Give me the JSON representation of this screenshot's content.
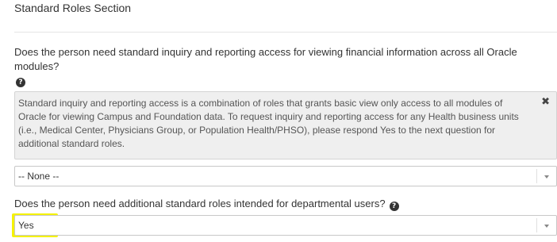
{
  "section": {
    "title": "Standard Roles Section"
  },
  "question1": {
    "text": "Does the person need standard inquiry and reporting access for viewing financial information across all Oracle modules?",
    "help_icon": "question-circle-icon",
    "help_glyph": "?",
    "info_text": "Standard inquiry and reporting access is a combination of roles that grants basic view only access to all modules of Oracle for viewing Campus and Foundation data.  To request inquiry and reporting access for any Health business units (i.e., Medical Center, Physicians Group, or Population Health/PHSO), please respond Yes to the next question for additional standard roles.",
    "close_glyph": "✖",
    "selected": "-- None --"
  },
  "question2": {
    "text": "Does the person need additional standard roles intended for departmental users?",
    "help_icon": "question-circle-icon",
    "help_glyph": "?",
    "selected": "Yes"
  },
  "colors": {
    "highlight": "#f5f200",
    "info_background": "#efefef"
  }
}
